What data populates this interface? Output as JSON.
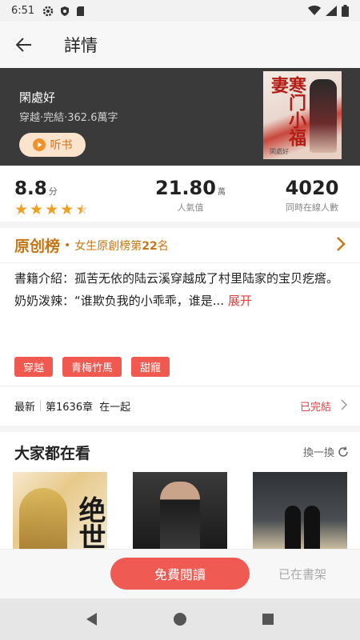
{
  "status_bar": {
    "time": "6:51"
  },
  "app_bar": {
    "title": "詳情"
  },
  "book": {
    "title": "閑處好",
    "meta": "穿越·完結·362.6萬字",
    "listen_label": "听书",
    "cover_text": "寒门小福妻",
    "cover_author": "閑處好"
  },
  "stats": {
    "rating": "8.8",
    "rating_unit": "分",
    "stars": 4.5,
    "popularity_value": "21.80",
    "popularity_unit": "萬",
    "popularity_label": "人氣值",
    "online_value": "4020",
    "online_label": "同時在線人數"
  },
  "rank": {
    "title": "原创榜",
    "sub_prefix": "女生原創榜第",
    "sub_number": "22",
    "sub_suffix": "名"
  },
  "intro": {
    "line1": "書籍介紹：孤苦无依的陆云溪穿越成了村里陆家的宝贝疙瘩。",
    "line2": "奶奶泼辣：“谁欺负我的小乖乖，谁是...",
    "expand": "展开"
  },
  "tags": [
    "穿越",
    "青梅竹馬",
    "甜寵"
  ],
  "latest": {
    "label": "最新",
    "chapter": "第1636章",
    "chapter_title": "在一起",
    "status": "已完結"
  },
  "recommend": {
    "title": "大家都在看",
    "refresh": "換一換"
  },
  "bottom": {
    "read_label": "免費閱讀",
    "shelf_label": "已在書架"
  },
  "colors": {
    "accent": "#ef5a52",
    "rank": "#c57716",
    "star": "#f0a020",
    "hero_bg": "#3a3a3a"
  }
}
